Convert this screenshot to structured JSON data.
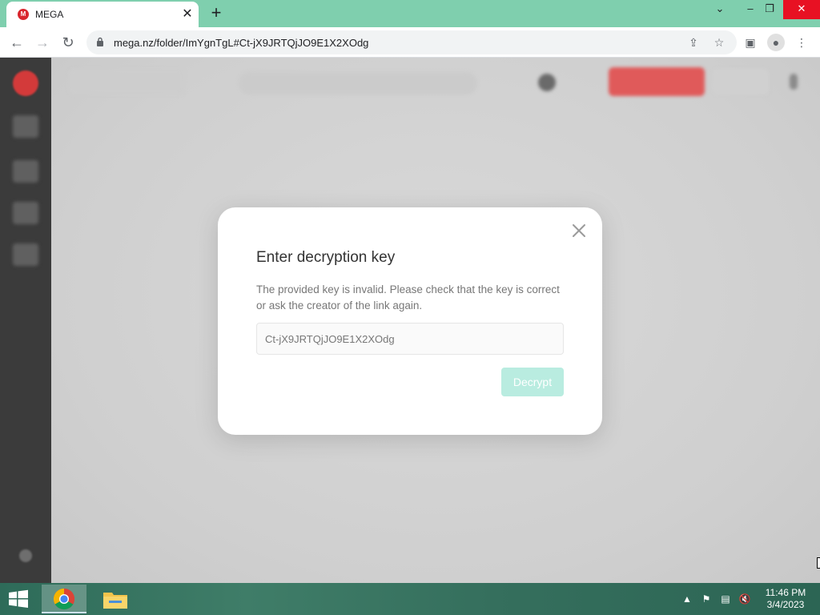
{
  "browser": {
    "tab_title": "MEGA",
    "tab_favicon_letter": "M",
    "url": "mega.nz/folder/ImYgnTgL#Ct-jX9JRTQjJO9E1X2XOdg"
  },
  "modal": {
    "title": "Enter decryption key",
    "message": "The provided key is invalid. Please check that the key is correct or ask the creator of the link again.",
    "key_value": "Ct-jX9JRTQjJO9E1X2XOdg",
    "decrypt_label": "Decrypt"
  },
  "taskbar": {
    "time": "11:46 PM",
    "date": "3/4/2023"
  },
  "colors": {
    "mega_red": "#d9272e",
    "decrypt_button_disabled": "#b9ece0",
    "tabstrip": "#7fcfae"
  }
}
